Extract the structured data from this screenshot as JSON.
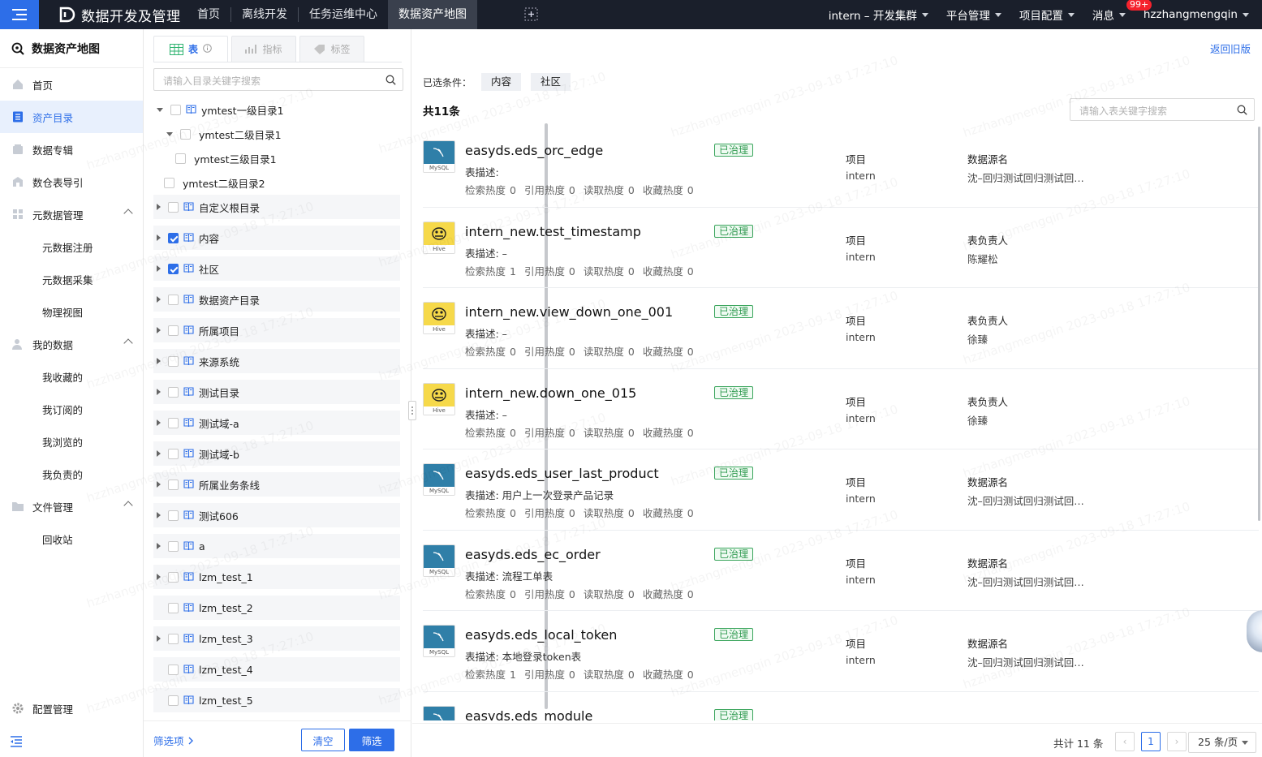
{
  "topbar": {
    "app_title": "数据开发及管理",
    "nav": [
      "首页",
      "离线开发",
      "任务运维中心",
      "数据资产地图"
    ],
    "active_nav": "数据资产地图",
    "cluster": "intern – 开发集群",
    "platform": "平台管理",
    "project_config": "项目配置",
    "messages": "消息",
    "message_badge": "99+",
    "username": "hzzhangmengqin"
  },
  "sidebar": {
    "title": "数据资产地图",
    "items": [
      {
        "label": "首页",
        "icon": "home-icon"
      },
      {
        "label": "资产目录",
        "icon": "catalog-icon",
        "active": true
      },
      {
        "label": "数据专辑",
        "icon": "album-icon"
      },
      {
        "label": "数仓表导引",
        "icon": "warehouse-icon"
      },
      {
        "label": "元数据管理",
        "icon": "grid-icon",
        "expanded": true,
        "children": [
          "元数据注册",
          "元数据采集",
          "物理视图"
        ]
      },
      {
        "label": "我的数据",
        "icon": "user-icon",
        "expanded": true,
        "children": [
          "我收藏的",
          "我订阅的",
          "我浏览的",
          "我负责的"
        ]
      },
      {
        "label": "文件管理",
        "icon": "folder-icon",
        "expanded": true,
        "children": [
          "回收站"
        ]
      }
    ],
    "bottom": "配置管理"
  },
  "tree_panel": {
    "tabs": [
      {
        "label": "表",
        "active": true
      },
      {
        "label": "指标"
      },
      {
        "label": "标签"
      }
    ],
    "search_placeholder": "请输入目录关键字搜索",
    "nodes": [
      {
        "label": "ymtest一级目录1",
        "level": 0,
        "expanded": true,
        "checked": false,
        "book": true
      },
      {
        "label": "ymtest二级目录1",
        "level": 1,
        "expanded": true,
        "checked": false,
        "book": false
      },
      {
        "label": "ymtest三级目录1",
        "level": 2,
        "checked": false,
        "book": false
      },
      {
        "label": "ymtest二级目录2",
        "level": 1,
        "checked": false,
        "book": false,
        "last_child": true
      },
      {
        "label": "自定义根目录",
        "level": 0,
        "checked": false,
        "book": true,
        "root": true
      },
      {
        "label": "内容",
        "level": 0,
        "checked": true,
        "book": true,
        "root": true
      },
      {
        "label": "社区",
        "level": 0,
        "checked": true,
        "book": true,
        "root": true
      },
      {
        "label": "数据资产目录",
        "level": 0,
        "checked": false,
        "book": true,
        "root": true
      },
      {
        "label": "所属项目",
        "level": 0,
        "checked": false,
        "book": true,
        "root": true
      },
      {
        "label": "来源系统",
        "level": 0,
        "checked": false,
        "book": true,
        "root": true
      },
      {
        "label": "测试目录",
        "level": 0,
        "checked": false,
        "book": true,
        "root": true
      },
      {
        "label": "测试域-a",
        "level": 0,
        "checked": false,
        "book": true,
        "root": true
      },
      {
        "label": "测试域-b",
        "level": 0,
        "checked": false,
        "book": true,
        "root": true
      },
      {
        "label": "所属业务条线",
        "level": 0,
        "checked": false,
        "book": true,
        "root": true
      },
      {
        "label": "测试606",
        "level": 0,
        "checked": false,
        "book": true,
        "root": true
      },
      {
        "label": "a",
        "level": 0,
        "checked": false,
        "book": true,
        "root": true
      },
      {
        "label": "lzm_test_1",
        "level": 0,
        "checked": false,
        "book": true,
        "root": true
      },
      {
        "label": "lzm_test_2",
        "level": 0,
        "checked": false,
        "book": true,
        "root": true,
        "leaf": true
      },
      {
        "label": "lzm_test_3",
        "level": 0,
        "checked": false,
        "book": true,
        "root": true
      },
      {
        "label": "lzm_test_4",
        "level": 0,
        "checked": false,
        "book": true,
        "root": true,
        "leaf": true
      },
      {
        "label": "lzm_test_5",
        "level": 0,
        "checked": false,
        "book": true,
        "root": true,
        "leaf": true
      }
    ],
    "filter_link": "筛选项",
    "clear_label": "清空",
    "filter_label": "筛选"
  },
  "main": {
    "back_label": "返回旧版",
    "conditions_label": "已选条件：",
    "conditions": [
      "内容",
      "社区"
    ],
    "total_label": "共11条",
    "search_placeholder": "请输入表关键字搜索",
    "rows": [
      {
        "type": "MySQL",
        "name": "easyds.eds_orc_edge",
        "status": "已治理",
        "desc": "表描述:",
        "heat": [
          "检索热度 0",
          "引用热度 0",
          "读取热度 0",
          "收藏热度 0"
        ],
        "m1_label": "项目",
        "m1_value": "intern",
        "m2_label": "数据源名",
        "m2_value": "沈–回归测试回归测试回…"
      },
      {
        "type": "Hive",
        "name": "intern_new.test_timestamp",
        "status": "已治理",
        "desc": "表描述: –",
        "heat": [
          "检索热度 1",
          "引用热度 0",
          "读取热度 0",
          "收藏热度 0"
        ],
        "m1_label": "项目",
        "m1_value": "intern",
        "m2_label": "表负责人",
        "m2_value": "陈耀松"
      },
      {
        "type": "Hive",
        "name": "intern_new.view_down_one_001",
        "status": "已治理",
        "desc": "表描述: –",
        "heat": [
          "检索热度 0",
          "引用热度 0",
          "读取热度 0",
          "收藏热度 0"
        ],
        "m1_label": "项目",
        "m1_value": "intern",
        "m2_label": "表负责人",
        "m2_value": "徐臻"
      },
      {
        "type": "Hive",
        "name": "intern_new.down_one_015",
        "status": "已治理",
        "desc": "表描述: –",
        "heat": [
          "检索热度 0",
          "引用热度 0",
          "读取热度 0",
          "收藏热度 0"
        ],
        "m1_label": "项目",
        "m1_value": "intern",
        "m2_label": "表负责人",
        "m2_value": "徐臻"
      },
      {
        "type": "MySQL",
        "name": "easyds.eds_user_last_product",
        "status": "已治理",
        "desc": "表描述: 用户上一次登录产品记录",
        "heat": [
          "检索热度 0",
          "引用热度 0",
          "读取热度 0",
          "收藏热度 0"
        ],
        "m1_label": "项目",
        "m1_value": "intern",
        "m2_label": "数据源名",
        "m2_value": "沈–回归测试回归测试回…"
      },
      {
        "type": "MySQL",
        "name": "easyds.eds_ec_order",
        "status": "已治理",
        "desc": "表描述: 流程工单表",
        "heat": [
          "检索热度 0",
          "引用热度 0",
          "读取热度 0",
          "收藏热度 0"
        ],
        "m1_label": "项目",
        "m1_value": "intern",
        "m2_label": "数据源名",
        "m2_value": "沈–回归测试回归测试回…"
      },
      {
        "type": "MySQL",
        "name": "easyds.eds_local_token",
        "status": "已治理",
        "desc": "表描述: 本地登录token表",
        "heat": [
          "检索热度 1",
          "引用热度 0",
          "读取热度 0",
          "收藏热度 0"
        ],
        "m1_label": "项目",
        "m1_value": "intern",
        "m2_label": "数据源名",
        "m2_value": "沈–回归测试回归测试回…"
      },
      {
        "type": "MySQL",
        "name": "easyds.eds_module",
        "status": "已治理",
        "desc": "",
        "heat": [],
        "m1_label": "",
        "m1_value": "",
        "m2_label": "",
        "m2_value": ""
      }
    ],
    "pager": {
      "total": "共计 11 条",
      "current": "1",
      "size": "25 条/页"
    }
  },
  "watermark": "hzzhangmengqin 2023-09-18 17:27:10",
  "colors": {
    "accent": "#2d6ee8",
    "topbar": "#1a1f2b",
    "governed": "#2f9a50",
    "mysql": "#2f7fa8",
    "hive": "#f6d94a"
  }
}
